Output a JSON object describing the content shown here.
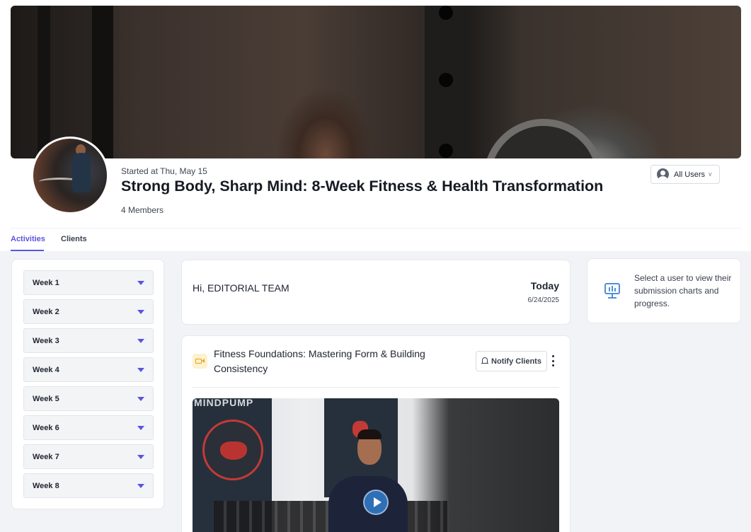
{
  "header": {
    "started_text": "Started at Thu, May 15",
    "title": "Strong Body, Sharp Mind: 8-Week Fitness & Health Transformation",
    "members_text": "4 Members",
    "user_filter_label": "All Users"
  },
  "tabs": [
    {
      "label": "Activities",
      "active": true
    },
    {
      "label": "Clients",
      "active": false
    }
  ],
  "weeks": [
    "Week 1",
    "Week 2",
    "Week 3",
    "Week 4",
    "Week 5",
    "Week 6",
    "Week 7",
    "Week 8"
  ],
  "greeting": {
    "text": "Hi, EDITORIAL TEAM",
    "day_label": "Today",
    "date": "6/24/2025"
  },
  "activity": {
    "title": "Fitness Foundations: Mastering Form & Building Consistency",
    "notify_label": "Notify Clients",
    "icon": "video-camera-icon",
    "video_brand_text": "MINDPUMP"
  },
  "side_panel": {
    "text": "Select a user to view their submission charts and progress.",
    "icon": "chart-monitor-icon"
  },
  "colors": {
    "accent": "#5b54e0",
    "chart_icon": "#4f8fd8",
    "video_icon": "#e3a322",
    "play_button": "#2f6fb6"
  }
}
